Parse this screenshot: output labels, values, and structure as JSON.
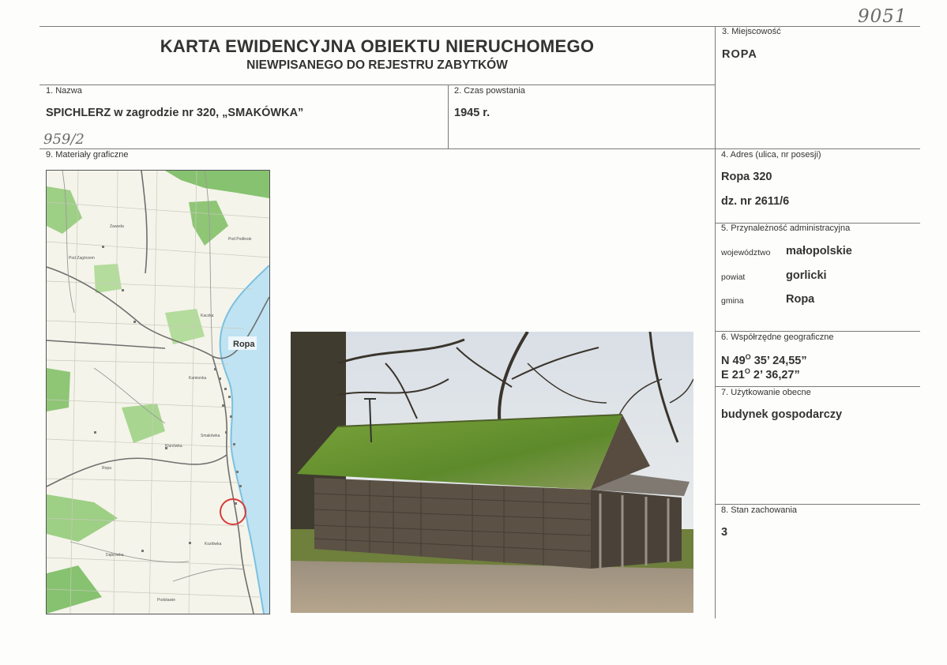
{
  "header": {
    "title": "KARTA EWIDENCYJNA OBIEKTU NIERUCHOMEGO",
    "subtitle": "NIEWPISANEGO DO REJESTRU ZABYTKÓW",
    "handwritten_number": "9051"
  },
  "fields": {
    "nazwa": {
      "label": "1. Nazwa",
      "value": "SPICHLERZ w zagrodzie nr 320, „SMAKÓWKA”"
    },
    "czas": {
      "label": "2. Czas powstania",
      "value": "1945 r."
    },
    "miejscowosc": {
      "label": "3. Miejscowość",
      "value": "ROPA"
    },
    "adres": {
      "label": "4. Adres (ulica, nr posesji)",
      "line1": "Ropa 320",
      "line2": "dz. nr 2611/6"
    },
    "przynaleznosc": {
      "label": "5. Przynależność administracyjna",
      "wojewodztwo_label": "województwo",
      "wojewodztwo": "małopolskie",
      "powiat_label": "powiat",
      "powiat": "gorlicki",
      "gmina_label": "gmina",
      "gmina": "Ropa"
    },
    "wspolrzedne": {
      "label": "6. Współrzędne geograficzne",
      "n_prefix": "N 49",
      "n_rest": "35’ 24,55”",
      "e_prefix": "E 21",
      "e_rest": "2’ 36,27”",
      "deg": "O"
    },
    "uzytkowanie": {
      "label": "7. Użytkowanie obecne",
      "value": "budynek gospodarczy"
    },
    "stan": {
      "label": "8. Stan zachowania",
      "value": "3"
    },
    "materialy": {
      "label": "9. Materiały graficzne",
      "handwritten_ref": "959/2"
    }
  },
  "map": {
    "town_label": "Ropa",
    "place_labels": [
      "Pod Zagórzem",
      "Pod Podlesie",
      "Kaczka",
      "Smakówka",
      "Ropa",
      "Kamionka",
      "Kozłówka",
      "Klunówka",
      "Dąbrowka",
      "Podstawie",
      "Zawoda"
    ]
  },
  "colors": {
    "map_river": "#9fd0ea",
    "map_forest": "#7fbf6a",
    "map_road": "#666666",
    "marker": "#d83a3a"
  }
}
